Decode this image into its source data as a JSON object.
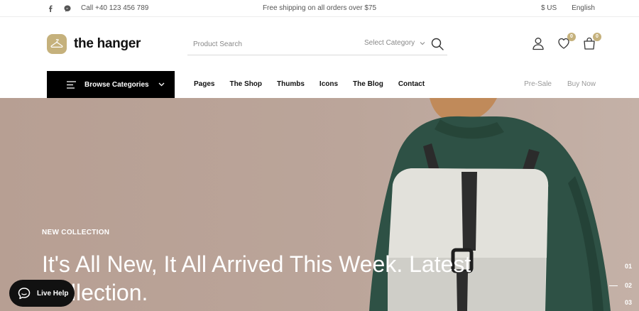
{
  "topbar": {
    "social": [
      "facebook-icon",
      "messenger-icon"
    ],
    "phone": "Call +40 123 456 789",
    "promo": "Free shipping on all orders over $75",
    "currency": "$ US",
    "language": "English"
  },
  "header": {
    "logo_text": "the hanger",
    "search_placeholder": "Product Search",
    "category_label": "Select Category",
    "wishlist_count": "0",
    "cart_count": "0"
  },
  "nav": {
    "browse_label": "Browse Categories",
    "links": [
      "Pages",
      "The Shop",
      "Thumbs",
      "Icons",
      "The Blog",
      "Contact"
    ],
    "right_links": [
      "Pre-Sale",
      "Buy Now"
    ]
  },
  "hero": {
    "eyebrow": "NEW COLLECTION",
    "headline": "It's All New, It All Arrived This Week. Latest Collection.",
    "slides": [
      "01",
      "02",
      "03"
    ]
  },
  "live_help": {
    "label": "Live Help"
  },
  "colors": {
    "accent": "#c5b17c",
    "hero_bg": "#bba59a",
    "nav_dark": "#000000"
  }
}
